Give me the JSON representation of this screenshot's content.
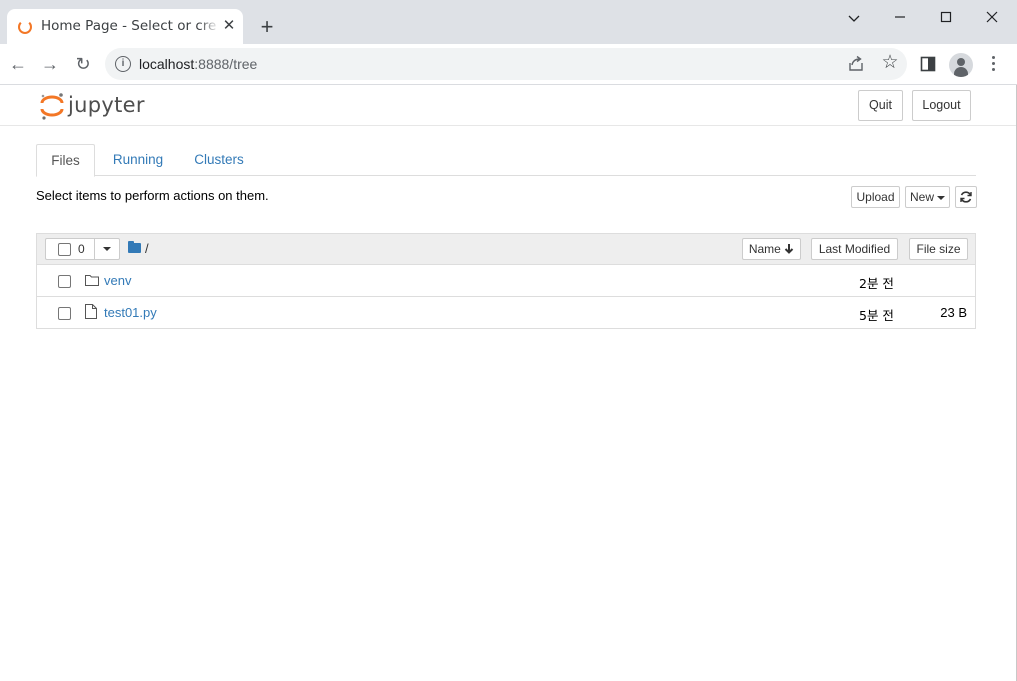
{
  "browser": {
    "tab_title": "Home Page - Select or create a notebook",
    "tab_close_glyph": "✕",
    "new_tab_glyph": "+",
    "url_host": "localhost",
    "url_port_path": ":8888/tree",
    "back_glyph": "←",
    "forward_glyph": "→",
    "reload_glyph": "↻",
    "star_glyph": "☆",
    "info_glyph": "i"
  },
  "header": {
    "logo_text": "jupyter",
    "quit_label": "Quit",
    "logout_label": "Logout"
  },
  "tabs": [
    {
      "label": "Files",
      "active": true
    },
    {
      "label": "Running",
      "active": false
    },
    {
      "label": "Clusters",
      "active": false
    }
  ],
  "toolbar": {
    "instruction": "Select items to perform actions on them.",
    "upload_label": "Upload",
    "new_label": "New"
  },
  "list": {
    "selected_count": "0",
    "breadcrumb_root": "/",
    "col_name": "Name",
    "col_modified": "Last Modified",
    "col_size": "File size",
    "items": [
      {
        "name": "venv",
        "type": "folder",
        "modified": "2분 전",
        "size": ""
      },
      {
        "name": "test01.py",
        "type": "file",
        "modified": "5분 전",
        "size": "23 B"
      }
    ]
  },
  "colors": {
    "jupyter_orange": "#f37726",
    "link_blue": "#337ab7",
    "chrome_frame": "#dee1e6"
  },
  "icons": [
    "tab-favicon-icon",
    "info-icon",
    "share-icon",
    "star-icon",
    "side-panel-icon",
    "profile-icon",
    "more-menu-icon",
    "folder-icon",
    "file-icon",
    "refresh-icon",
    "sort-arrow-down-icon"
  ]
}
